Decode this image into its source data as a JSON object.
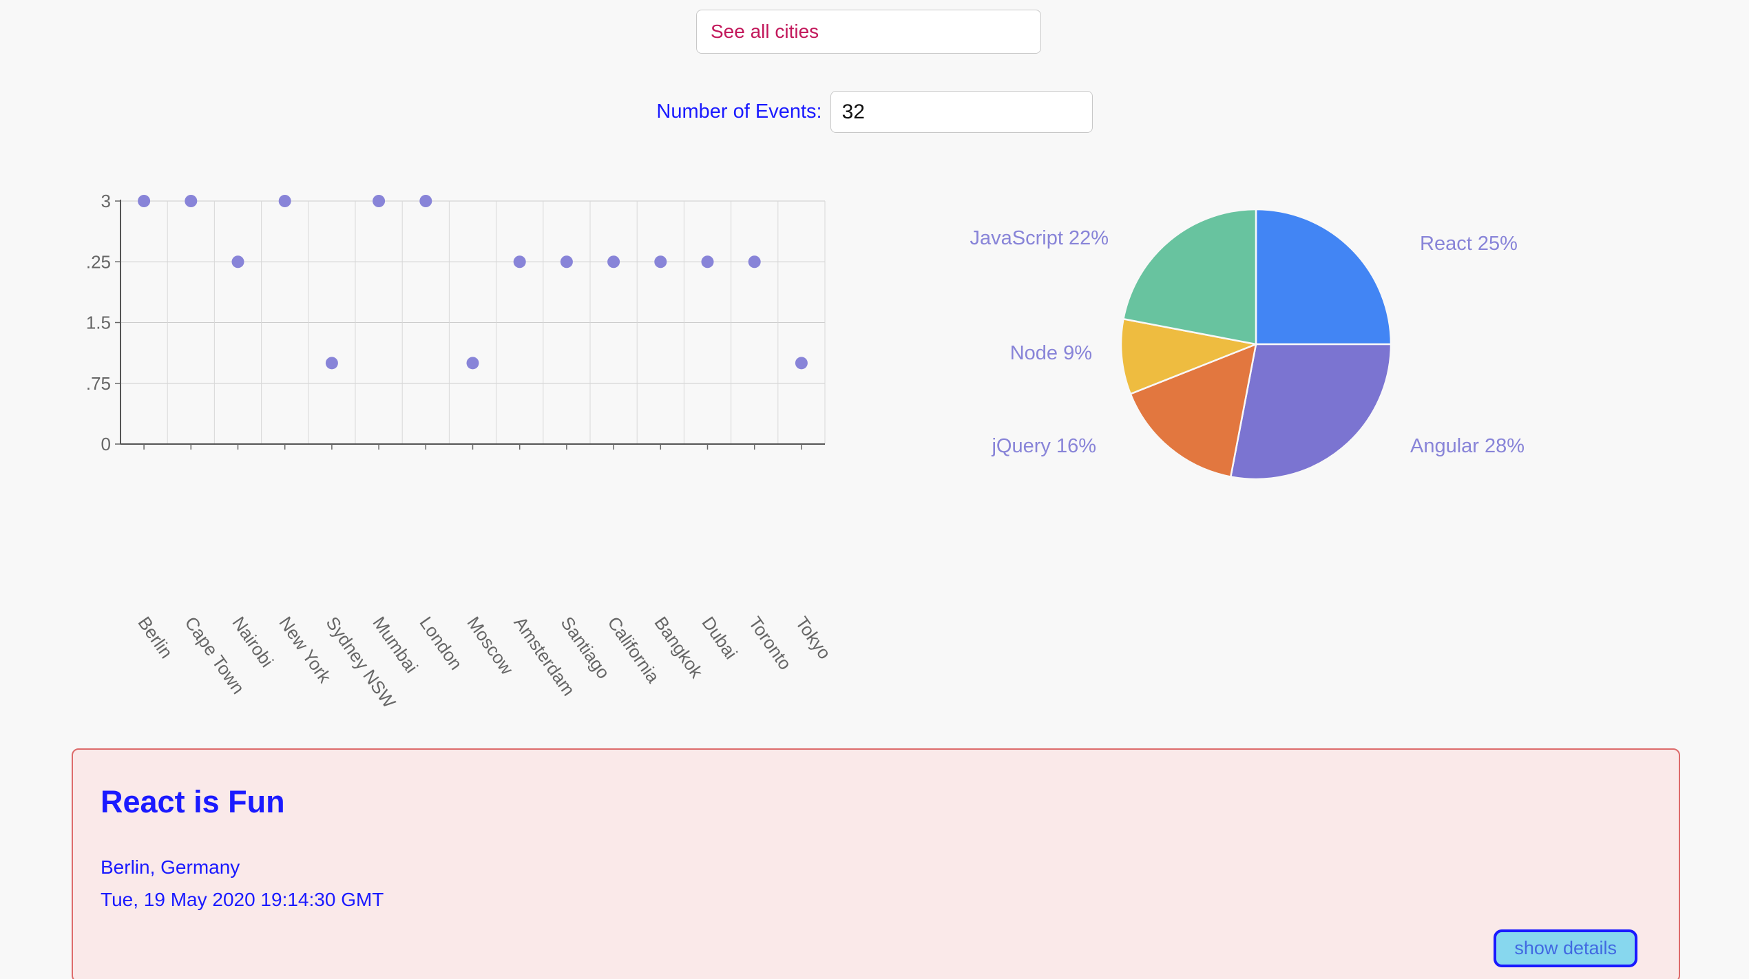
{
  "search": {
    "placeholder": "See all cities",
    "value": "",
    "text_color": "#c2185b"
  },
  "events_control": {
    "label": "Number of Events:",
    "value": "32",
    "label_color": "#1a1aff"
  },
  "chart_data": [
    {
      "type": "scatter",
      "title": "",
      "xlabel": "",
      "ylabel": "",
      "categories": [
        "Berlin",
        "Cape Town",
        "Nairobi",
        "New York",
        "Sydney NSW",
        "Mumbai",
        "London",
        "Moscow",
        "Amsterdam",
        "Santiago",
        "California",
        "Bangkok",
        "Dubai",
        "Toronto",
        "Tokyo"
      ],
      "y_tick_labels": [
        "3",
        ".25",
        "1.5",
        ".75",
        "0"
      ],
      "y_tick_values": [
        3,
        2.25,
        1.5,
        0.75,
        0
      ],
      "ylim": [
        0,
        3
      ],
      "grid": true,
      "point_color": "#8884d8",
      "points": [
        {
          "city": "Berlin",
          "value": 3
        },
        {
          "city": "Cape Town",
          "value": 3
        },
        {
          "city": "Nairobi",
          "value": 2.25
        },
        {
          "city": "New York",
          "value": 3
        },
        {
          "city": "Sydney NSW",
          "value": 1
        },
        {
          "city": "Mumbai",
          "value": 3
        },
        {
          "city": "London",
          "value": 3
        },
        {
          "city": "Moscow",
          "value": 1
        },
        {
          "city": "Amsterdam",
          "value": 2.25
        },
        {
          "city": "Santiago",
          "value": 2.25
        },
        {
          "city": "California",
          "value": 2.25
        },
        {
          "city": "Bangkok",
          "value": 2.25
        },
        {
          "city": "Dubai",
          "value": 2.25
        },
        {
          "city": "Toronto",
          "value": 2.25
        },
        {
          "city": "Tokyo",
          "value": 1
        }
      ]
    },
    {
      "type": "pie",
      "title": "",
      "legend_position": "outside-labels",
      "label_color": "#8884d8",
      "slices": [
        {
          "name": "React",
          "percent": 25,
          "label": "React 25%",
          "color": "#4285f4"
        },
        {
          "name": "Angular",
          "percent": 28,
          "label": "Angular 28%",
          "color": "#7b74d1"
        },
        {
          "name": "jQuery",
          "percent": 16,
          "label": "jQuery 16%",
          "color": "#e2773f"
        },
        {
          "name": "Node",
          "percent": 9,
          "label": "Node 9%",
          "color": "#eebc40"
        },
        {
          "name": "JavaScript",
          "percent": 22,
          "label": "JavaScript 22%",
          "color": "#68c39f"
        }
      ]
    }
  ],
  "event_card": {
    "title": "React is Fun",
    "location": "Berlin, Germany",
    "date": "Tue, 19 May 2020 19:14:30 GMT",
    "details_button": "show details",
    "background": "#fae9e9",
    "border_color": "#dd6b6b"
  }
}
